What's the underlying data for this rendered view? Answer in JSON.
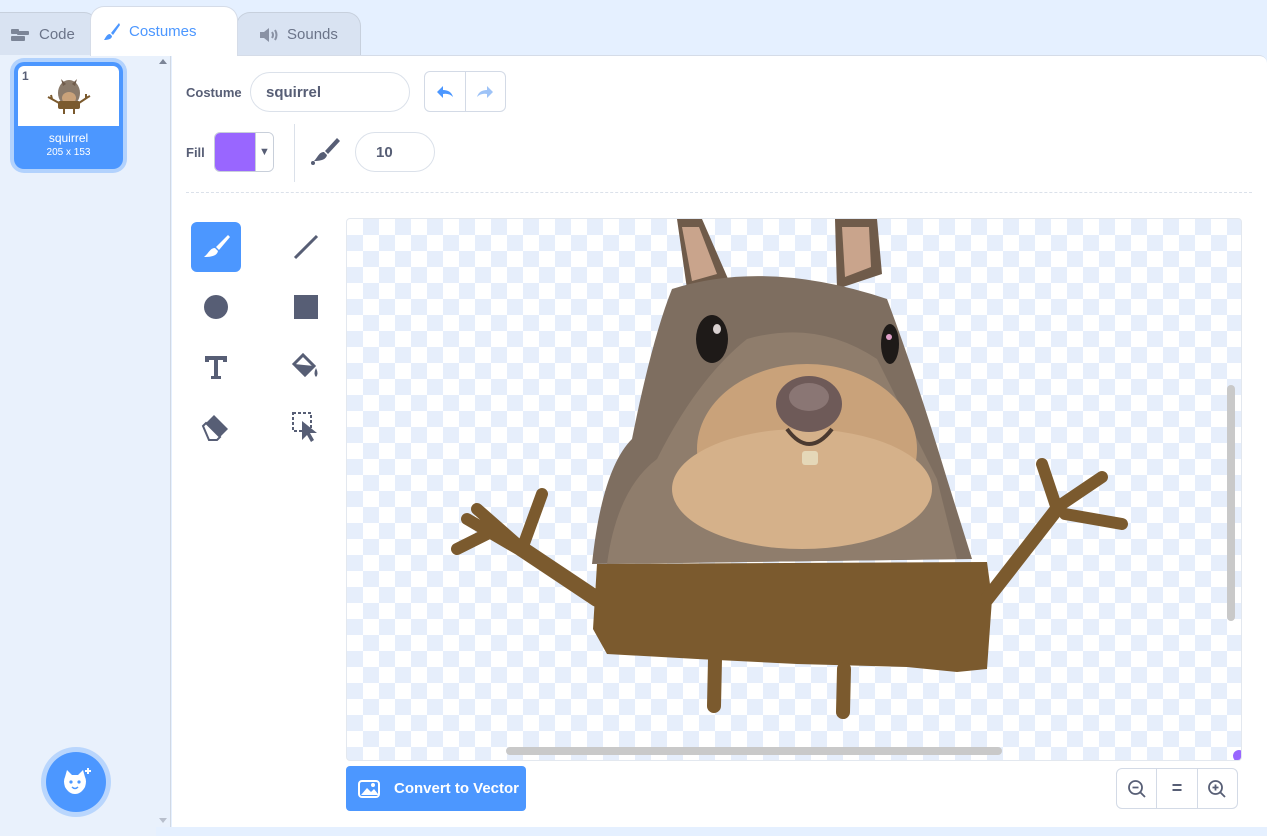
{
  "tabs": {
    "code": "Code",
    "costumes": "Costumes",
    "sounds": "Sounds"
  },
  "costume_list": {
    "items": [
      {
        "number": "1",
        "name": "squirrel",
        "size": "205 x 153",
        "selected": true
      }
    ]
  },
  "toolbar": {
    "costume_label": "Costume",
    "costume_name": "squirrel",
    "fill_label": "Fill",
    "fill_color": "#9966ff",
    "brush_size": "10"
  },
  "tools": [
    "brush-icon",
    "line-icon",
    "circle-icon",
    "rectangle-icon",
    "text-icon",
    "fill-icon",
    "eraser-icon",
    "select-icon"
  ],
  "footer": {
    "convert_label": "Convert to Vector",
    "zoom_reset": "="
  },
  "colors": {
    "accent": "#4c97ff",
    "squirrel_body": "#7b5a2e"
  }
}
